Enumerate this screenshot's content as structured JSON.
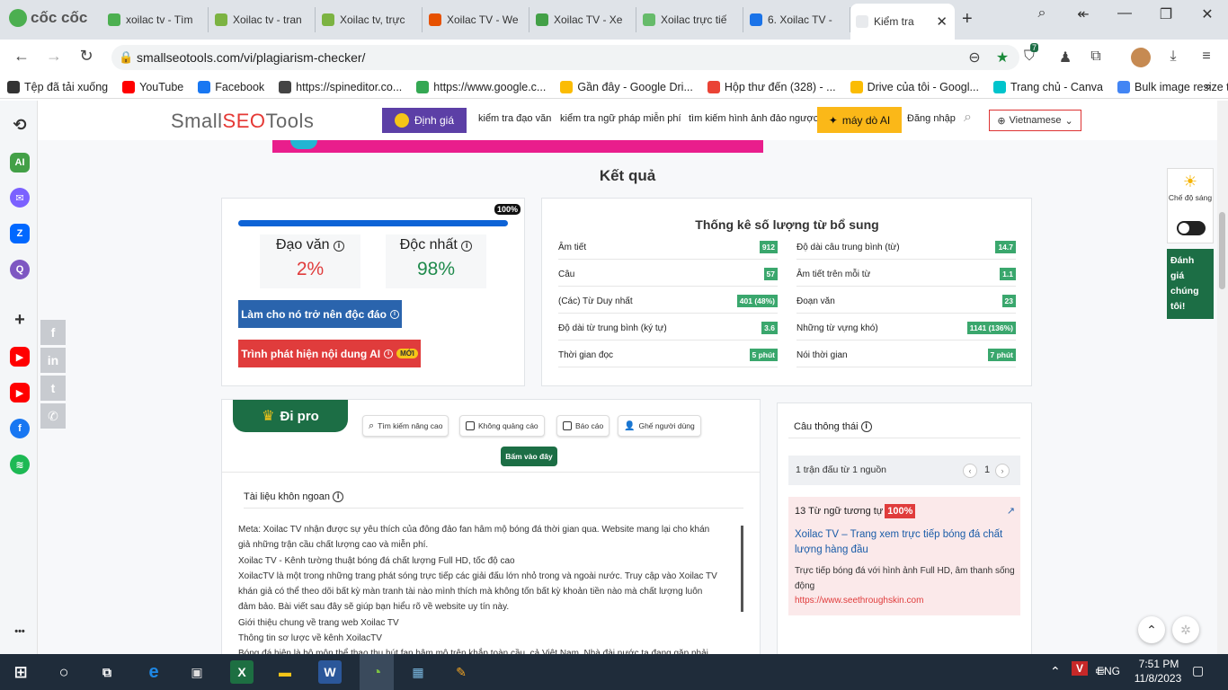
{
  "browser": {
    "brand": "cốc cốc",
    "tabs": [
      {
        "title": "xoilac tv - Tìm",
        "color": "#4caf50"
      },
      {
        "title": "Xoilac tv - tran",
        "color": "#7cb342"
      },
      {
        "title": "Xoilac tv, trực",
        "color": "#7cb342"
      },
      {
        "title": "Xoilac TV - We",
        "color": "#e65100"
      },
      {
        "title": "Xoilac TV - Xe",
        "color": "#43a047"
      },
      {
        "title": "Xoilac trực tiế",
        "color": "#66bb6a"
      },
      {
        "title": "6. Xoilac TV - ",
        "color": "#1a73e8"
      },
      {
        "title": "Kiểm tra ",
        "color": "#ffffff"
      }
    ],
    "url": "smallseotools.com/vi/plagiarism-checker/",
    "extension_badge": "7",
    "bookmarks": [
      {
        "label": "Tệp đã tải xuống",
        "color": "#333333"
      },
      {
        "label": "YouTube",
        "color": "#ff0000"
      },
      {
        "label": "Facebook",
        "color": "#1877f2"
      },
      {
        "label": "https://spineditor.co...",
        "color": "#444444"
      },
      {
        "label": "https://www.google.c...",
        "color": "#34a853"
      },
      {
        "label": "Gần đây - Google Dri...",
        "color": "#fbbc04"
      },
      {
        "label": "Hộp thư đến (328) - ...",
        "color": "#ea4335"
      },
      {
        "label": "Drive của tôi - Googl...",
        "color": "#fbbc04"
      },
      {
        "label": "Trang chủ - Canva",
        "color": "#00c4cc"
      },
      {
        "label": "Bulk image resize to...",
        "color": "#4285f4"
      }
    ]
  },
  "site": {
    "logo_a": "Small",
    "logo_b": "SEO",
    "logo_c": "Tools",
    "pricing": "Định giá",
    "nav": [
      "kiểm tra đạo văn",
      "kiểm tra ngữ pháp miễn phí",
      "tìm kiếm hình ảnh đảo ngược"
    ],
    "ai_btn": "máy dò AI",
    "login": "Đăng nhập",
    "language": "Vietnamese"
  },
  "result": {
    "title": "Kết quả",
    "progress_label": "100%",
    "progress": 1.0,
    "plag_label": "Đạo văn",
    "plag_value": "2%",
    "unique_label": "Độc nhất",
    "unique_value": "98%",
    "unique_btn": "Làm cho nó trở nên độc đáo",
    "ai_detect_btn": "Trình phát hiện nội dung AI",
    "new_badge": "MỚI"
  },
  "word_stats": {
    "title": "Thống kê số lượng từ bổ sung",
    "left": [
      {
        "label": "Âm tiết",
        "value": "912"
      },
      {
        "label": "Câu",
        "value": "57"
      },
      {
        "label": "(Các) Từ Duy nhất",
        "value": "401 (48%)"
      },
      {
        "label": "Độ dài từ trung bình (ký tự)",
        "value": "3.6"
      },
      {
        "label": "Thời gian đọc",
        "value": "5 phút"
      }
    ],
    "right": [
      {
        "label": "Độ dài câu trung bình (từ)",
        "value": "14.7"
      },
      {
        "label": "Âm tiết trên mỗi từ",
        "value": "1.1"
      },
      {
        "label": "Đoạn văn",
        "value": "23"
      },
      {
        "label": "Những từ vựng khó)",
        "value": "1141 (136%)"
      },
      {
        "label": "Nói thời gian",
        "value": "7 phút"
      }
    ]
  },
  "pro": {
    "tab": "Đi pro",
    "features": [
      "Tìm kiếm nâng cao",
      "Không quảng cáo",
      "Báo cáo",
      "Ghế người dùng"
    ],
    "click_btn": "Bấm vào đây",
    "doc_title": "Tài liệu khôn ngoan",
    "doc_lines": [
      "Meta: Xoilac TV nhận được sự yêu thích của đông đảo fan hâm mộ bóng đá thời gian qua. Website mang lại cho khán",
      "giả những trận cầu chất lượng cao và miễn phí.",
      "Xoilac TV - Kênh tường thuật bóng đá chất lượng Full HD, tốc độ cao",
      "XoilacTV là một trong những trang phát sóng trực tiếp các giải đấu lớn nhỏ trong và ngoài nước. Truy cập vào Xoilac TV",
      "khán giả có thể theo dõi bất kỳ màn tranh tài nào mình thích mà không tốn bất kỳ khoản tiền nào mà chất lượng luôn",
      "đảm bảo. Bài viết sau đây sẽ giúp bạn hiểu rõ về website uy tín này.",
      "Giới thiệu chung về trang web Xoilac TV",
      "Thông tin sơ lược về kênh XoilacTV",
      "Bóng đá hiện là bộ môn thể thao thu hút fan hâm mộ trên khắp toàn cầu, cả Việt Nam. Nhà đài nước ta đang gặp phải"
    ]
  },
  "sources": {
    "title": "Câu thông thái",
    "summary": "1 trận đấu từ 1 nguồn",
    "page": "1",
    "match_text": "13 Từ ngữ tương tự",
    "match_pct": "100%",
    "match_title": "Xoilac TV – Trang xem trực tiếp bóng đá chất lượng hàng đầu",
    "match_desc": "Trực tiếp bóng đá với hình ảnh Full HD, âm thanh sống động",
    "match_url": "https://www.seethroughskin.com"
  },
  "widgets": {
    "theme_label": "Chế độ sáng",
    "rate_label": "Đánh giá chúng tôi!"
  },
  "taskbar": {
    "lang": "ENG",
    "time": "7:51 PM",
    "date": "11/8/2023"
  }
}
